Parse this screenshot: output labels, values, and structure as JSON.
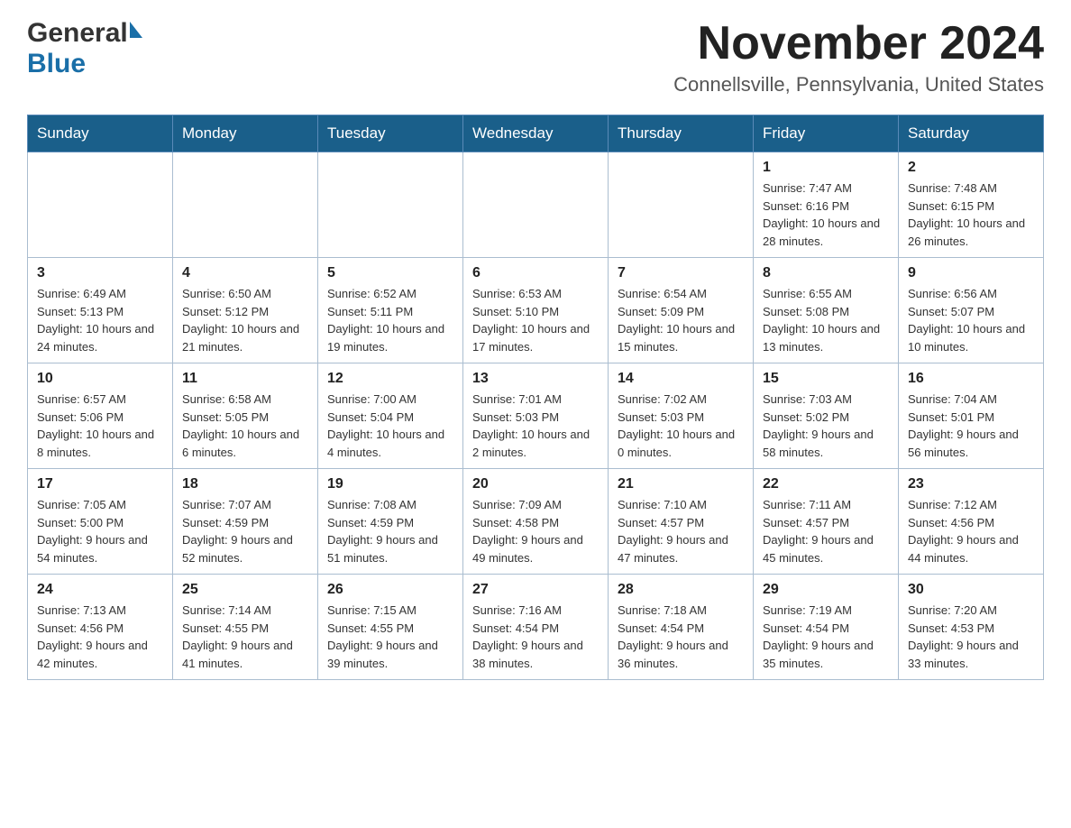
{
  "header": {
    "month_title": "November 2024",
    "location": "Connellsville, Pennsylvania, United States",
    "logo_general": "General",
    "logo_blue": "Blue"
  },
  "weekdays": [
    "Sunday",
    "Monday",
    "Tuesday",
    "Wednesday",
    "Thursday",
    "Friday",
    "Saturday"
  ],
  "weeks": [
    [
      {
        "day": "",
        "sunrise": "",
        "sunset": "",
        "daylight": ""
      },
      {
        "day": "",
        "sunrise": "",
        "sunset": "",
        "daylight": ""
      },
      {
        "day": "",
        "sunrise": "",
        "sunset": "",
        "daylight": ""
      },
      {
        "day": "",
        "sunrise": "",
        "sunset": "",
        "daylight": ""
      },
      {
        "day": "",
        "sunrise": "",
        "sunset": "",
        "daylight": ""
      },
      {
        "day": "1",
        "sunrise": "Sunrise: 7:47 AM",
        "sunset": "Sunset: 6:16 PM",
        "daylight": "Daylight: 10 hours and 28 minutes."
      },
      {
        "day": "2",
        "sunrise": "Sunrise: 7:48 AM",
        "sunset": "Sunset: 6:15 PM",
        "daylight": "Daylight: 10 hours and 26 minutes."
      }
    ],
    [
      {
        "day": "3",
        "sunrise": "Sunrise: 6:49 AM",
        "sunset": "Sunset: 5:13 PM",
        "daylight": "Daylight: 10 hours and 24 minutes."
      },
      {
        "day": "4",
        "sunrise": "Sunrise: 6:50 AM",
        "sunset": "Sunset: 5:12 PM",
        "daylight": "Daylight: 10 hours and 21 minutes."
      },
      {
        "day": "5",
        "sunrise": "Sunrise: 6:52 AM",
        "sunset": "Sunset: 5:11 PM",
        "daylight": "Daylight: 10 hours and 19 minutes."
      },
      {
        "day": "6",
        "sunrise": "Sunrise: 6:53 AM",
        "sunset": "Sunset: 5:10 PM",
        "daylight": "Daylight: 10 hours and 17 minutes."
      },
      {
        "day": "7",
        "sunrise": "Sunrise: 6:54 AM",
        "sunset": "Sunset: 5:09 PM",
        "daylight": "Daylight: 10 hours and 15 minutes."
      },
      {
        "day": "8",
        "sunrise": "Sunrise: 6:55 AM",
        "sunset": "Sunset: 5:08 PM",
        "daylight": "Daylight: 10 hours and 13 minutes."
      },
      {
        "day": "9",
        "sunrise": "Sunrise: 6:56 AM",
        "sunset": "Sunset: 5:07 PM",
        "daylight": "Daylight: 10 hours and 10 minutes."
      }
    ],
    [
      {
        "day": "10",
        "sunrise": "Sunrise: 6:57 AM",
        "sunset": "Sunset: 5:06 PM",
        "daylight": "Daylight: 10 hours and 8 minutes."
      },
      {
        "day": "11",
        "sunrise": "Sunrise: 6:58 AM",
        "sunset": "Sunset: 5:05 PM",
        "daylight": "Daylight: 10 hours and 6 minutes."
      },
      {
        "day": "12",
        "sunrise": "Sunrise: 7:00 AM",
        "sunset": "Sunset: 5:04 PM",
        "daylight": "Daylight: 10 hours and 4 minutes."
      },
      {
        "day": "13",
        "sunrise": "Sunrise: 7:01 AM",
        "sunset": "Sunset: 5:03 PM",
        "daylight": "Daylight: 10 hours and 2 minutes."
      },
      {
        "day": "14",
        "sunrise": "Sunrise: 7:02 AM",
        "sunset": "Sunset: 5:03 PM",
        "daylight": "Daylight: 10 hours and 0 minutes."
      },
      {
        "day": "15",
        "sunrise": "Sunrise: 7:03 AM",
        "sunset": "Sunset: 5:02 PM",
        "daylight": "Daylight: 9 hours and 58 minutes."
      },
      {
        "day": "16",
        "sunrise": "Sunrise: 7:04 AM",
        "sunset": "Sunset: 5:01 PM",
        "daylight": "Daylight: 9 hours and 56 minutes."
      }
    ],
    [
      {
        "day": "17",
        "sunrise": "Sunrise: 7:05 AM",
        "sunset": "Sunset: 5:00 PM",
        "daylight": "Daylight: 9 hours and 54 minutes."
      },
      {
        "day": "18",
        "sunrise": "Sunrise: 7:07 AM",
        "sunset": "Sunset: 4:59 PM",
        "daylight": "Daylight: 9 hours and 52 minutes."
      },
      {
        "day": "19",
        "sunrise": "Sunrise: 7:08 AM",
        "sunset": "Sunset: 4:59 PM",
        "daylight": "Daylight: 9 hours and 51 minutes."
      },
      {
        "day": "20",
        "sunrise": "Sunrise: 7:09 AM",
        "sunset": "Sunset: 4:58 PM",
        "daylight": "Daylight: 9 hours and 49 minutes."
      },
      {
        "day": "21",
        "sunrise": "Sunrise: 7:10 AM",
        "sunset": "Sunset: 4:57 PM",
        "daylight": "Daylight: 9 hours and 47 minutes."
      },
      {
        "day": "22",
        "sunrise": "Sunrise: 7:11 AM",
        "sunset": "Sunset: 4:57 PM",
        "daylight": "Daylight: 9 hours and 45 minutes."
      },
      {
        "day": "23",
        "sunrise": "Sunrise: 7:12 AM",
        "sunset": "Sunset: 4:56 PM",
        "daylight": "Daylight: 9 hours and 44 minutes."
      }
    ],
    [
      {
        "day": "24",
        "sunrise": "Sunrise: 7:13 AM",
        "sunset": "Sunset: 4:56 PM",
        "daylight": "Daylight: 9 hours and 42 minutes."
      },
      {
        "day": "25",
        "sunrise": "Sunrise: 7:14 AM",
        "sunset": "Sunset: 4:55 PM",
        "daylight": "Daylight: 9 hours and 41 minutes."
      },
      {
        "day": "26",
        "sunrise": "Sunrise: 7:15 AM",
        "sunset": "Sunset: 4:55 PM",
        "daylight": "Daylight: 9 hours and 39 minutes."
      },
      {
        "day": "27",
        "sunrise": "Sunrise: 7:16 AM",
        "sunset": "Sunset: 4:54 PM",
        "daylight": "Daylight: 9 hours and 38 minutes."
      },
      {
        "day": "28",
        "sunrise": "Sunrise: 7:18 AM",
        "sunset": "Sunset: 4:54 PM",
        "daylight": "Daylight: 9 hours and 36 minutes."
      },
      {
        "day": "29",
        "sunrise": "Sunrise: 7:19 AM",
        "sunset": "Sunset: 4:54 PM",
        "daylight": "Daylight: 9 hours and 35 minutes."
      },
      {
        "day": "30",
        "sunrise": "Sunrise: 7:20 AM",
        "sunset": "Sunset: 4:53 PM",
        "daylight": "Daylight: 9 hours and 33 minutes."
      }
    ]
  ]
}
